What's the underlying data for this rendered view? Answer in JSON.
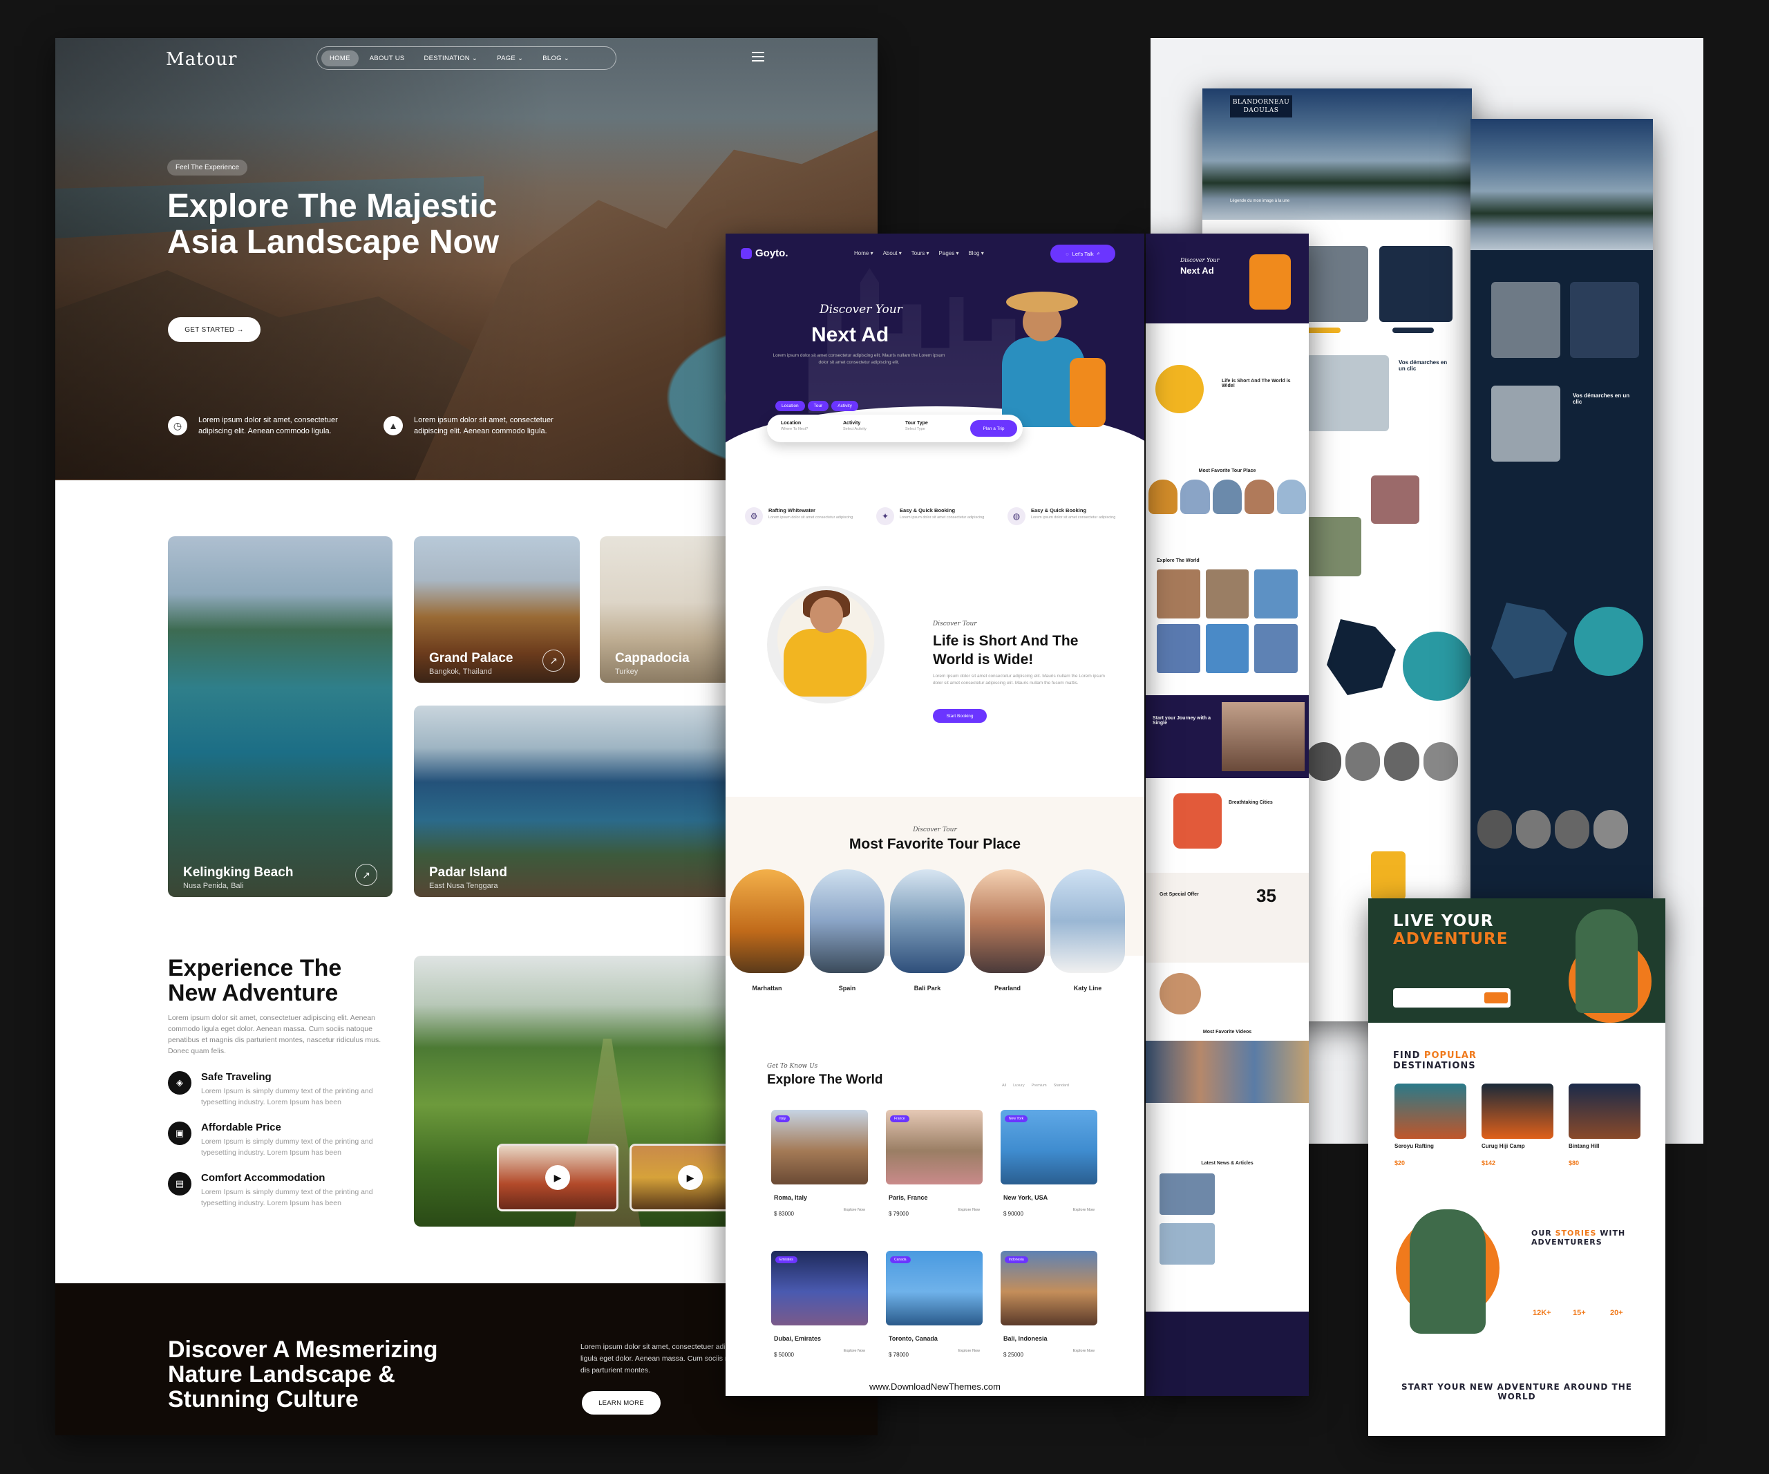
{
  "matour": {
    "logo": "Matour",
    "nav": [
      "HOME",
      "ABOUT US",
      "DESTINATION ⌄",
      "PAGE ⌄",
      "BLOG ⌄"
    ],
    "tag": "Feel The Experience",
    "headline": "Explore The Majestic Asia Landscape Now",
    "cta": "GET STARTED →",
    "features": [
      "Lorem ipsum dolor sit amet, consectetuer adipiscing elit. Aenean commodo ligula.",
      "Lorem ipsum dolor sit amet, consectetuer adipiscing elit. Aenean commodo ligula."
    ],
    "destinations": [
      {
        "name": "Kelingking Beach",
        "location": "Nusa Penida, Bali"
      },
      {
        "name": "Grand Palace",
        "location": "Bangkok, Thailand"
      },
      {
        "name": "Cappadocia",
        "location": "Turkey"
      },
      {
        "name": "Padar Island",
        "location": "East Nusa Tenggara"
      }
    ],
    "experience": {
      "title": "Experience The New Adventure",
      "text": "Lorem ipsum dolor sit amet, consectetuer adipiscing elit. Aenean commodo ligula eget dolor. Aenean massa. Cum sociis natoque penatibus et magnis dis parturient montes, nascetur ridiculus mus. Donec quam felis.",
      "items": [
        {
          "title": "Safe Traveling",
          "text": "Lorem Ipsum is simply dummy text of the printing and typesetting industry. Lorem Ipsum has been"
        },
        {
          "title": "Affordable Price",
          "text": "Lorem Ipsum is simply dummy text of the printing and typesetting industry. Lorem Ipsum has been"
        },
        {
          "title": "Comfort Accommodation",
          "text": "Lorem Ipsum is simply dummy text of the printing and typesetting industry. Lorem Ipsum has been"
        }
      ]
    },
    "footer": {
      "title": "Discover A Mesmerizing Nature Landscape & Stunning Culture",
      "text": "Lorem ipsum dolor sit amet, consectetuer adipiscing elit. Aenean commodo ligula eget dolor. Aenean massa. Cum sociis natoque penatibus et magnis dis parturient montes.",
      "cta": "LEARN MORE"
    }
  },
  "goyto": {
    "logo": "Goyto.",
    "nav": [
      "Home ▾",
      "About ▾",
      "Tours ▾",
      "Pages ▾",
      "Blog ▾"
    ],
    "cta": "Let's Talk",
    "hero_script": "Discover Your",
    "hero_title": "Next Ad",
    "hero_text": "Lorem ipsum dolor sit amet consectetur adipiscing elit. Mauris nullam the Lorem ipsum dolor sit amet consectetur adipiscing elit.",
    "search_tabs": [
      "Location",
      "Tour",
      "Activity"
    ],
    "search_fields": [
      {
        "label": "Location",
        "hint": "Where To Next?"
      },
      {
        "label": "Activity",
        "hint": "Select Activity"
      },
      {
        "label": "Tour Type",
        "hint": "Select Type"
      }
    ],
    "search_button": "Plan a Trip",
    "features": [
      {
        "title": "Rafting Whitewater",
        "text": "Lorem ipsum dolor sit amet consectetur adipiscing"
      },
      {
        "title": "Easy & Quick Booking",
        "text": "Lorem ipsum dolor sit amet consectetur adipiscing"
      },
      {
        "title": "Easy & Quick Booking",
        "text": "Lorem ipsum dolor sit amet consectetur adipiscing"
      }
    ],
    "about": {
      "script": "Discover Tour",
      "title": "Life is Short And The World is Wide!",
      "text": "Lorem ipsum dolor sit amet consectetur adipiscing elit. Mauris nullam the Lorem ipsum dolor sit amet consectetur adipiscing elit. Mauris nullam the fusom mattis.",
      "button": "Start Booking"
    },
    "favorite": {
      "script": "Discover Tour",
      "title": "Most Favorite Tour Place",
      "places": [
        "Marhattan",
        "Spain",
        "Bali Park",
        "Pearland",
        "Katy Line"
      ],
      "tag": "Tour"
    },
    "explore": {
      "script": "Get To Know Us",
      "title": "Explore The World",
      "tabs": [
        "All",
        "Luxury",
        "Premium",
        "Standard"
      ],
      "tours": [
        {
          "badge": "Italy",
          "name": "Roma, Italy",
          "price": "$ 83000",
          "cta": "Explore Now"
        },
        {
          "badge": "France",
          "name": "Paris, France",
          "price": "$ 79000",
          "cta": "Explore Now"
        },
        {
          "badge": "New York",
          "name": "New York, USA",
          "price": "$ 90000",
          "cta": "Explore Now"
        },
        {
          "badge": "Emirates",
          "name": "Dubai, Emirates",
          "price": "$ 50000",
          "cta": "Explore Now"
        },
        {
          "badge": "Canada",
          "name": "Toronto, Canada",
          "price": "$ 78000",
          "cta": "Explore Now"
        },
        {
          "badge": "Indonesia",
          "name": "Bali, Indonesia",
          "price": "$ 25000",
          "cta": "Explore Now"
        }
      ]
    },
    "watermark": "www.DownloadNewThemes.com"
  },
  "mobile_strip": {
    "hero_script": "Discover Your",
    "hero_title": "Next Ad",
    "about_title": "Life is Short And The World is Wide!",
    "fav_title": "Most Favorite Tour Place",
    "explore_title": "Explore The World",
    "journey_title": "Start your Journey with a Single",
    "cities_title": "Breathtaking Cities",
    "offer_title": "Get Special Offer",
    "offer_value": "35",
    "videos_title": "Most Favorite Videos",
    "news_title": "Latest News & Articles"
  },
  "blandorneau": {
    "logo": "BLANDORNEAU DAOULAS",
    "caption": "Légende du mon image à la une",
    "section": "Vos démarches en un clic",
    "dark_section": "Vos démarches en un clic"
  },
  "adventure": {
    "hero_title_1": "LIVE YOUR",
    "hero_title_2": "ADVENTURE",
    "popular_1": "FIND",
    "popular_2": "POPULAR",
    "popular_3": "DESTINATIONS",
    "cards": [
      {
        "name": "Seroyu Rafting",
        "price": "$20"
      },
      {
        "name": "Curug Hiji Camp",
        "price": "$142"
      },
      {
        "name": "Bintang Hill",
        "price": "$80"
      }
    ],
    "stories_1": "OUR",
    "stories_2": "STORIES",
    "stories_3": "WITH ADVENTURERS",
    "stats": [
      "12K+",
      "15+",
      "20+"
    ],
    "closing": "START YOUR NEW ADVENTURE AROUND THE WORLD",
    "closing_accent": "ADVENTURE"
  }
}
